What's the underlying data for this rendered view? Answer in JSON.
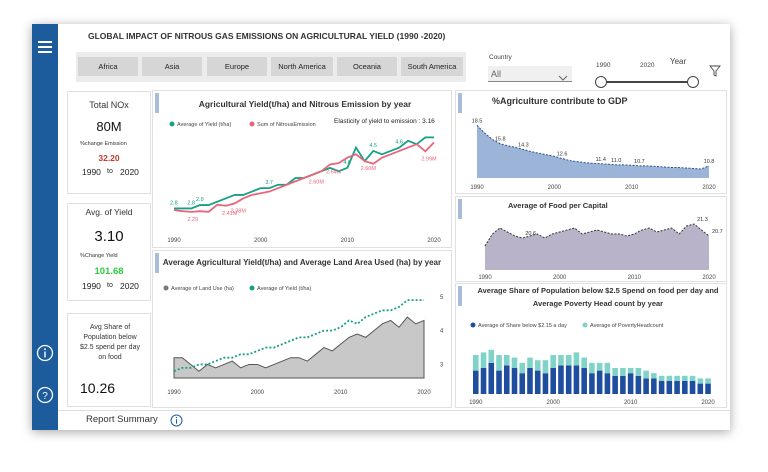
{
  "header": {
    "title": "GLOBAL IMPACT OF NITROUS GAS EMISSIONS ON AGRICULTURAL YIELD (1990 -2020)"
  },
  "region_buttons": [
    "Africa",
    "Asia",
    "Europe",
    "North America",
    "Oceania",
    "South America"
  ],
  "country": {
    "label": "Country",
    "value": "All"
  },
  "year_slider": {
    "label": "Year",
    "start": "1990",
    "end": "2020"
  },
  "kpi_nox": {
    "title": "Total NOx",
    "value": "80M",
    "change_label": "%change Emission",
    "change_value": "32.20",
    "from": "1990",
    "to_word": "to",
    "to": "2020"
  },
  "kpi_yield": {
    "title": "Avg. of Yield",
    "value": "3.10",
    "change_label": "%Change Yield",
    "change_value": "101.68",
    "from": "1990",
    "to_word": "to",
    "to": "2020"
  },
  "kpi_share": {
    "title": "Avg Share of Population below $2.5 spend per day on food",
    "value": "10.26"
  },
  "footer": {
    "tab_label": "Report Summary"
  },
  "colors": {
    "rail": "#1d5c9c",
    "teal": "#16a085",
    "pink": "#e8667a",
    "area_blue": "#9bb4d8",
    "bar_dark": "#1f4e9e",
    "bar_light": "#7fd3c8",
    "gray_area": "#c8c8c8"
  },
  "chart_data": [
    {
      "type": "line",
      "title": "Agricultural Yield(t/ha) and  Nitrous Emission  by year",
      "annotation": "Elasticity of yield to emission : 3.16",
      "x": [
        1990,
        1991,
        1992,
        1993,
        1994,
        1995,
        1996,
        1997,
        1998,
        1999,
        2000,
        2001,
        2002,
        2003,
        2004,
        2005,
        2006,
        2007,
        2008,
        2009,
        2010,
        2011,
        2012,
        2013,
        2014,
        2015,
        2016,
        2017,
        2018,
        2019,
        2020
      ],
      "x_ticks": [
        "1990",
        "2000",
        "2010",
        "2020"
      ],
      "series": [
        {
          "name": "Average of Yield (t/ha)",
          "values": [
            2.8,
            2.8,
            2.8,
            2.9,
            2.9,
            3.0,
            3.1,
            3.2,
            3.2,
            3.3,
            3.4,
            3.4,
            3.5,
            3.5,
            3.7,
            3.7,
            3.8,
            3.9,
            4.0,
            3.9,
            4.0,
            4.6,
            4.2,
            4.5,
            4.4,
            4.5,
            4.6,
            4.8,
            4.7,
            4.9,
            4.9
          ]
        },
        {
          "name": "Sum of NitrousEmission",
          "values": [
            2.25,
            2.22,
            2.2,
            2.22,
            2.2,
            2.41,
            2.38,
            2.45,
            2.6,
            2.7,
            2.75,
            2.8,
            2.9,
            3.0,
            3.1,
            3.2,
            3.3,
            3.4,
            3.6,
            3.64,
            3.8,
            3.9,
            3.7,
            3.62,
            3.8,
            3.9,
            4.0,
            4.1,
            4.2,
            3.99,
            4.25
          ]
        }
      ],
      "data_labels": {
        "yield": [
          [
            "1990",
            "2.8"
          ],
          [
            "1992",
            "2.8"
          ],
          [
            "1993",
            "2.9"
          ],
          [
            "2001",
            "3.7"
          ],
          [
            "2010",
            "4.6"
          ],
          [
            "2013",
            "4.5"
          ],
          [
            "2016",
            "4.6"
          ]
        ],
        "emission": [
          [
            "1992",
            "2.29"
          ],
          [
            "1996",
            "2.41M"
          ],
          [
            "1997",
            "2.38M"
          ],
          [
            "2006",
            "2.60M"
          ],
          [
            "2008",
            "2.64M"
          ],
          [
            "2012",
            "2.60M"
          ],
          [
            "2019",
            "2.99M"
          ]
        ]
      }
    },
    {
      "type": "area",
      "title": "%Agriculture contribute to GDP",
      "x": [
        1990,
        1991,
        1992,
        1993,
        1994,
        1995,
        1996,
        1997,
        1998,
        1999,
        2000,
        2001,
        2002,
        2003,
        2004,
        2005,
        2006,
        2007,
        2008,
        2009,
        2010,
        2011,
        2012,
        2013,
        2014,
        2015,
        2016,
        2017,
        2018,
        2019,
        2020
      ],
      "values": [
        18.5,
        17.0,
        15.8,
        15.0,
        14.6,
        14.3,
        13.9,
        13.5,
        13.2,
        12.9,
        12.6,
        12.2,
        11.8,
        11.6,
        11.4,
        11.3,
        11.2,
        11.1,
        11.0,
        11.0,
        10.9,
        10.8,
        10.8,
        10.7,
        10.6,
        10.5,
        10.5,
        10.4,
        10.3,
        10.2,
        10.8
      ],
      "labels": [
        [
          "1990",
          "18.5"
        ],
        [
          "1993",
          "15.8"
        ],
        [
          "1996",
          "14.3"
        ],
        [
          "2001",
          "12.6"
        ],
        [
          "2006",
          "11.4"
        ],
        [
          "2008",
          "11.0"
        ],
        [
          "2011",
          "10.7"
        ],
        [
          "2020",
          "10.8"
        ]
      ],
      "x_ticks": [
        "1990",
        "2000",
        "2010",
        "2020"
      ]
    },
    {
      "type": "area",
      "title": "Average of Food per Capital",
      "x": [
        1990,
        1991,
        1992,
        1993,
        1994,
        1995,
        1996,
        1997,
        1998,
        1999,
        2000,
        2001,
        2002,
        2003,
        2004,
        2005,
        2006,
        2007,
        2008,
        2009,
        2010,
        2011,
        2012,
        2013,
        2014,
        2015,
        2016,
        2017,
        2018,
        2019,
        2020
      ],
      "values": [
        20.2,
        20.8,
        21.1,
        20.9,
        20.7,
        20.6,
        20.7,
        20.8,
        20.6,
        20.8,
        20.9,
        21.0,
        21.1,
        20.8,
        20.9,
        21.0,
        20.9,
        20.8,
        20.8,
        20.7,
        20.8,
        21.0,
        21.1,
        20.9,
        21.0,
        21.1,
        20.8,
        21.2,
        21.3,
        21.0,
        20.7
      ],
      "labels": [
        [
          "1995",
          "20.6"
        ],
        [
          "2018",
          "21.3"
        ],
        [
          "2020",
          "20.7"
        ]
      ],
      "x_ticks": [
        "1990",
        "2000",
        "2010",
        "2020"
      ]
    },
    {
      "type": "bar",
      "title": "Average Share of Population below $2.5 Spend on food per day and Average Poverty Head count by year",
      "x": [
        1990,
        1991,
        1992,
        1993,
        1994,
        1995,
        1996,
        1997,
        1998,
        1999,
        2000,
        2001,
        2002,
        2003,
        2004,
        2005,
        2006,
        2007,
        2008,
        2009,
        2010,
        2011,
        2012,
        2013,
        2014,
        2015,
        2016,
        2017,
        2018,
        2019,
        2020
      ],
      "series": [
        {
          "name": "Average of Share below $2.15 a day",
          "values": [
            9,
            10,
            12,
            9,
            11,
            10,
            8,
            10,
            9,
            8,
            10,
            11,
            11,
            11,
            10,
            8,
            9,
            8,
            7,
            7,
            8,
            7,
            6,
            6,
            5,
            5,
            5,
            5,
            5,
            4,
            4
          ]
        },
        {
          "name": "Average of PovertyHeadcount",
          "values": [
            6,
            6,
            5,
            6,
            4,
            4,
            4,
            4,
            4,
            5,
            5,
            4,
            4,
            5,
            4,
            4,
            3,
            4,
            3,
            3,
            2,
            3,
            3,
            2,
            2,
            2,
            2,
            2,
            2,
            2,
            2
          ]
        }
      ],
      "x_ticks": [
        "1990",
        "2000",
        "2010",
        "2020"
      ]
    },
    {
      "type": "area",
      "title": "Average Agricultural Yield(t/ha) and Average Land Area Used (ha) by year",
      "x": [
        1990,
        1991,
        1992,
        1993,
        1994,
        1995,
        1996,
        1997,
        1998,
        1999,
        2000,
        2001,
        2002,
        2003,
        2004,
        2005,
        2006,
        2007,
        2008,
        2009,
        2010,
        2011,
        2012,
        2013,
        2014,
        2015,
        2016,
        2017,
        2018,
        2019,
        2020
      ],
      "series": [
        {
          "name": "Average of Land Use (ha)",
          "values": [
            3.2,
            3.2,
            3.0,
            2.8,
            3.0,
            2.9,
            3.0,
            3.1,
            2.9,
            3.0,
            3.0,
            2.9,
            3.0,
            3.1,
            3.2,
            3.2,
            3.1,
            3.3,
            3.5,
            3.4,
            3.6,
            3.8,
            3.9,
            3.8,
            4.0,
            4.2,
            4.3,
            4.1,
            4.4,
            4.2,
            4.3
          ]
        },
        {
          "name": "Average of Yield (t/ha)",
          "values": [
            2.8,
            2.9,
            2.9,
            3.0,
            3.0,
            3.1,
            3.2,
            3.2,
            3.3,
            3.3,
            3.4,
            3.5,
            3.5,
            3.6,
            3.7,
            3.8,
            3.8,
            3.9,
            4.0,
            4.0,
            4.1,
            4.3,
            4.2,
            4.4,
            4.5,
            4.6,
            4.6,
            4.7,
            4.9,
            4.9,
            4.9
          ]
        }
      ],
      "x_ticks": [
        "1990",
        "2000",
        "2010",
        "2020"
      ],
      "y_ticks": [
        "3",
        "4",
        "5"
      ]
    }
  ]
}
